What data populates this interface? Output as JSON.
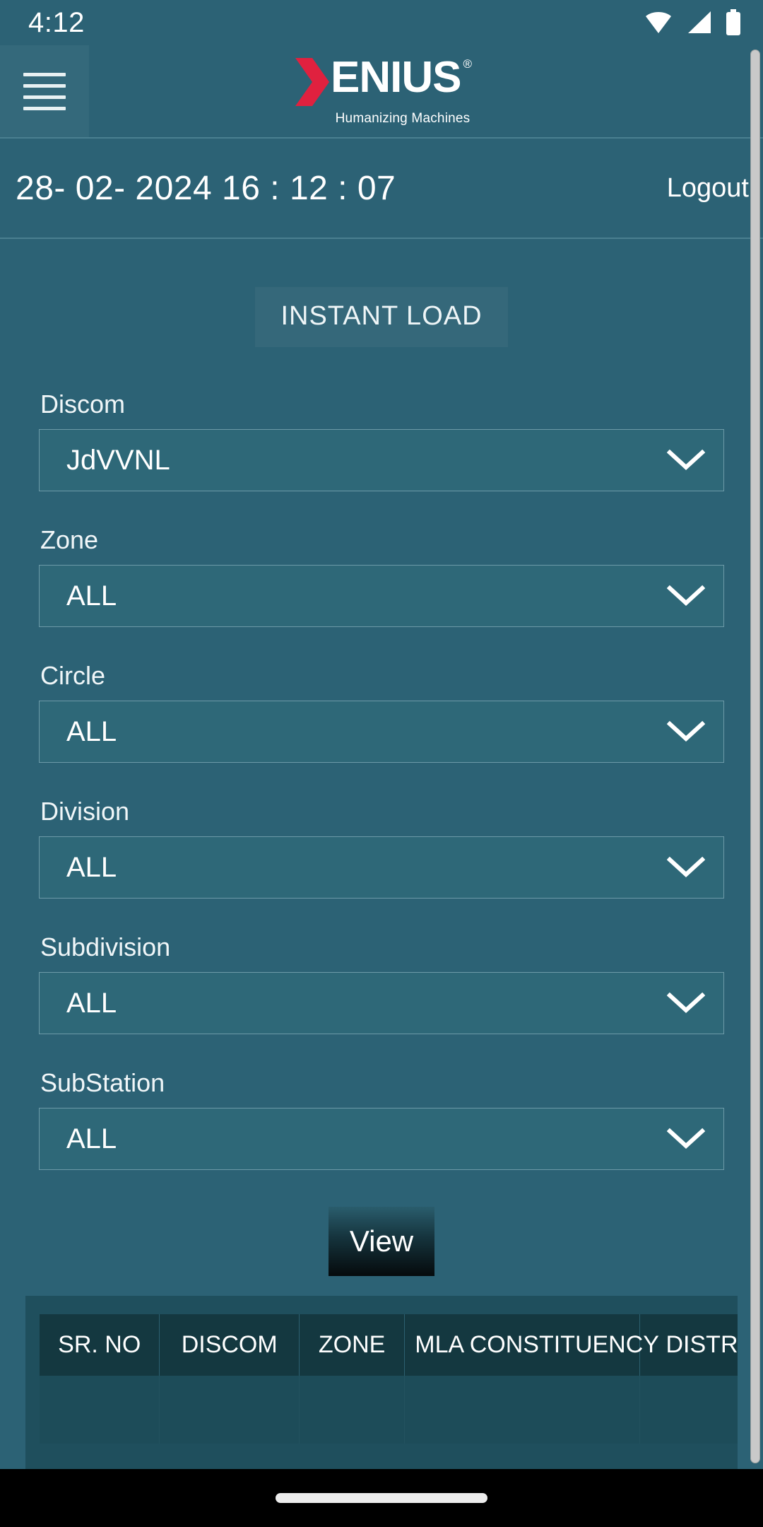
{
  "status_bar": {
    "time": "4:12",
    "icons": [
      "wifi-icon",
      "cellular-signal-icon",
      "battery-icon"
    ]
  },
  "app_bar": {
    "menu_icon": "hamburger-menu-icon",
    "logo": {
      "chevron": "X",
      "name": "ENIUS",
      "registered": "®",
      "tagline": "Humanizing Machines",
      "chevron_color": "#e0213f",
      "text_color": "#ffffff"
    }
  },
  "date_bar": {
    "datetime": "28- 02- 2024 16 : 12 : 07",
    "logout_label": "Logout"
  },
  "main": {
    "page_title": "INSTANT LOAD",
    "fields": [
      {
        "label": "Discom",
        "value": "JdVVNL",
        "icon": "chevron-down-icon"
      },
      {
        "label": "Zone",
        "value": "ALL",
        "icon": "chevron-down-icon"
      },
      {
        "label": "Circle",
        "value": "ALL",
        "icon": "chevron-down-icon"
      },
      {
        "label": "Division",
        "value": "ALL",
        "icon": "chevron-down-icon"
      },
      {
        "label": "Subdivision",
        "value": "ALL",
        "icon": "chevron-down-icon"
      },
      {
        "label": "SubStation",
        "value": "ALL",
        "icon": "chevron-down-icon"
      }
    ],
    "view_button": "View",
    "table": {
      "columns": [
        "SR. NO",
        "DISCOM",
        "ZONE",
        "MLA CONSTITUENCY",
        "DISTRICT"
      ],
      "rows": []
    }
  },
  "theme": {
    "background": "#2c6275",
    "panel": "#1f4f5d",
    "table_header": "#143840",
    "accent_red": "#e0213f",
    "border": "#6d9aa8",
    "text": "#ffffff"
  },
  "nav_bar": {
    "gesture_pill": "home-gesture-pill"
  }
}
